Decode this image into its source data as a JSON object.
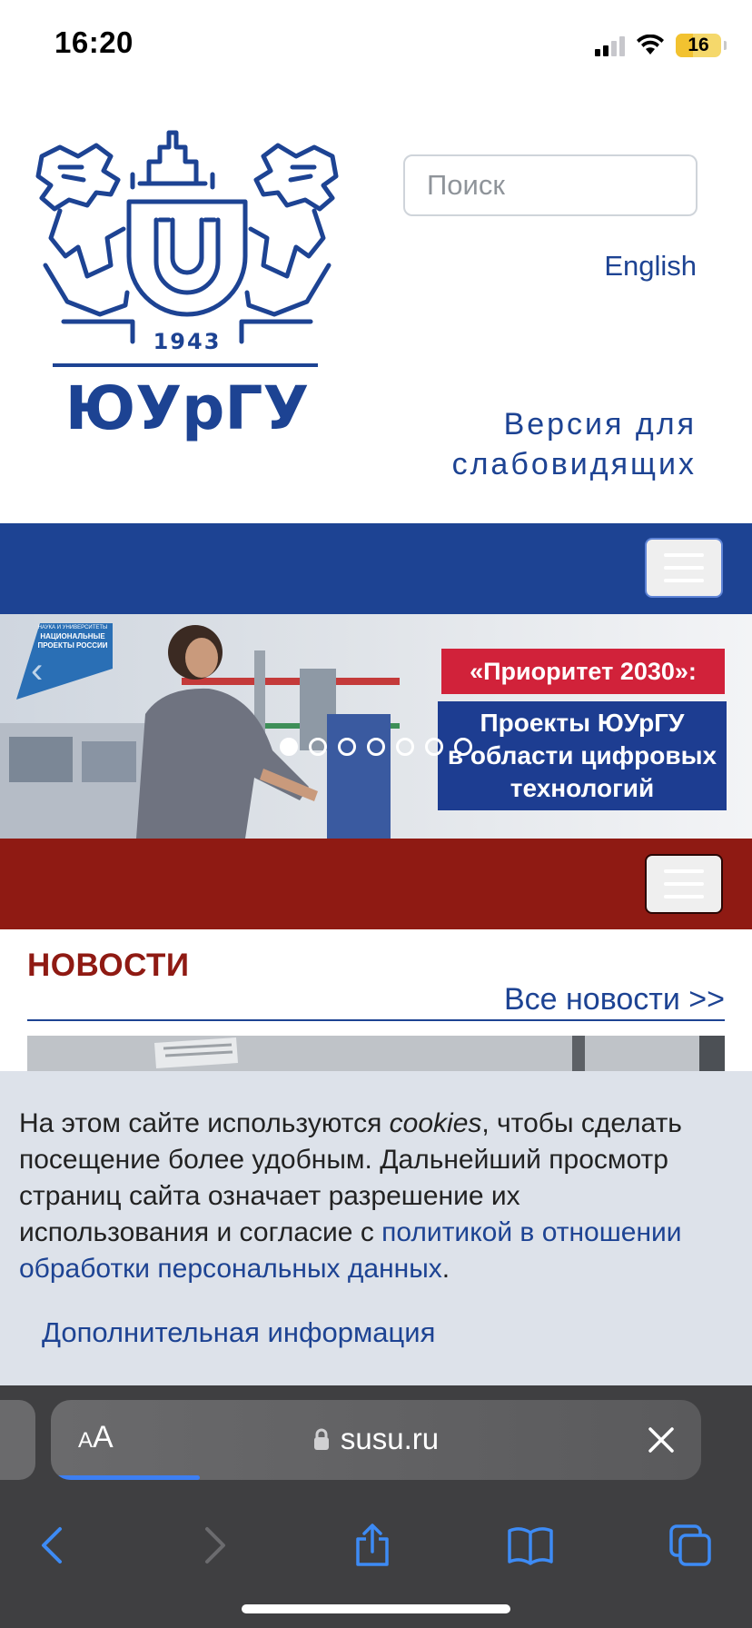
{
  "status_bar": {
    "time": "16:20",
    "battery": "16",
    "icons": [
      "signal-icon",
      "wifi-icon",
      "battery-icon"
    ]
  },
  "header": {
    "logo_year": "1943",
    "logo_name": "ЮУрГУ",
    "search_placeholder": "Поиск",
    "language_link": "English",
    "accessibility_line1": "Версия для",
    "accessibility_line2": "слабовидящих"
  },
  "banner": {
    "badge_small": "НАУКА И УНИВЕРСИТЕТЫ",
    "badge_main": "НАЦИОНАЛЬНЫЕ ПРОЕКТЫ РОССИИ",
    "title": "«Приоритет 2030»:",
    "subtitle_line1": "Проекты ЮУрГУ",
    "subtitle_line2": "в области цифровых",
    "subtitle_line3": "технологий",
    "slides_total": 7,
    "active_slide": 1
  },
  "news": {
    "title": "НОВОСТИ",
    "all_news_link": "Все новости >>"
  },
  "cookie_notice": {
    "text_before": "На этом сайте используются ",
    "text_emph": "cookies",
    "text_middle": ", чтобы сделать посещение более удобным. Дальнейший просмотр страниц сайта означает разрешение их использования и согласие с ",
    "policy_link": "политикой в отношении обработки персональных данных",
    "text_after": ".",
    "more_info_link": "Дополнительная информация"
  },
  "browser": {
    "aa_label_small": "A",
    "aa_label_large": "A",
    "url": "susu.ru",
    "load_progress": 0.22,
    "toolbar": [
      "back-icon",
      "forward-icon",
      "share-icon",
      "bookmarks-icon",
      "tabs-icon"
    ]
  },
  "colors": {
    "brand_blue": "#1d4393",
    "brand_red": "#8f1a13",
    "banner_red": "#d1223a",
    "cookie_bg": "#dde2ea",
    "safari_bg": "#3f3f41"
  }
}
